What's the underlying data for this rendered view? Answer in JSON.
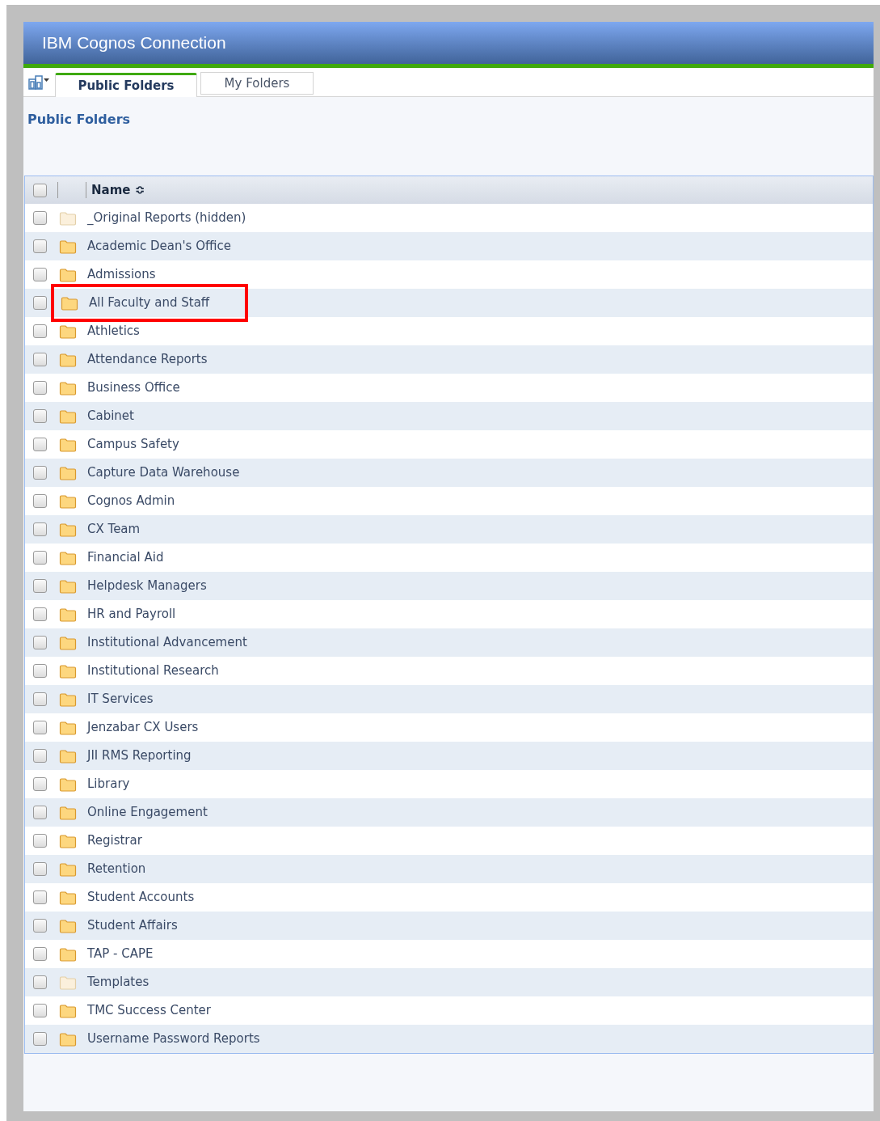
{
  "window": {
    "title": "IBM Cognos Connection"
  },
  "tabs": [
    {
      "label": "Public Folders",
      "selected": true
    },
    {
      "label": "My Folders",
      "selected": false
    }
  ],
  "breadcrumb": "Public Folders",
  "table": {
    "header_checked": false,
    "columns": [
      {
        "label": "Name",
        "sort_icon": "≎"
      }
    ],
    "rows": [
      {
        "name": "_Original Reports (hidden)",
        "hidden": true,
        "checked": false,
        "highlighted": false
      },
      {
        "name": "Academic Dean's Office",
        "hidden": false,
        "checked": false,
        "highlighted": false
      },
      {
        "name": "Admissions",
        "hidden": false,
        "checked": false,
        "highlighted": false
      },
      {
        "name": "All Faculty and Staff",
        "hidden": false,
        "checked": false,
        "highlighted": true
      },
      {
        "name": "Athletics",
        "hidden": false,
        "checked": false,
        "highlighted": false
      },
      {
        "name": "Attendance Reports",
        "hidden": false,
        "checked": false,
        "highlighted": false
      },
      {
        "name": "Business Office",
        "hidden": false,
        "checked": false,
        "highlighted": false
      },
      {
        "name": "Cabinet",
        "hidden": false,
        "checked": false,
        "highlighted": false
      },
      {
        "name": "Campus Safety",
        "hidden": false,
        "checked": false,
        "highlighted": false
      },
      {
        "name": "Capture Data Warehouse",
        "hidden": false,
        "checked": false,
        "highlighted": false
      },
      {
        "name": "Cognos Admin",
        "hidden": false,
        "checked": false,
        "highlighted": false
      },
      {
        "name": "CX Team",
        "hidden": false,
        "checked": false,
        "highlighted": false
      },
      {
        "name": "Financial Aid",
        "hidden": false,
        "checked": false,
        "highlighted": false
      },
      {
        "name": "Helpdesk Managers",
        "hidden": false,
        "checked": false,
        "highlighted": false
      },
      {
        "name": "HR and Payroll",
        "hidden": false,
        "checked": false,
        "highlighted": false
      },
      {
        "name": "Institutional Advancement",
        "hidden": false,
        "checked": false,
        "highlighted": false
      },
      {
        "name": "Institutional Research",
        "hidden": false,
        "checked": false,
        "highlighted": false
      },
      {
        "name": "IT Services",
        "hidden": false,
        "checked": false,
        "highlighted": false
      },
      {
        "name": "Jenzabar CX Users",
        "hidden": false,
        "checked": false,
        "highlighted": false
      },
      {
        "name": "JII RMS Reporting",
        "hidden": false,
        "checked": false,
        "highlighted": false
      },
      {
        "name": "Library",
        "hidden": false,
        "checked": false,
        "highlighted": false
      },
      {
        "name": "Online Engagement",
        "hidden": false,
        "checked": false,
        "highlighted": false
      },
      {
        "name": "Registrar",
        "hidden": false,
        "checked": false,
        "highlighted": false
      },
      {
        "name": "Retention",
        "hidden": false,
        "checked": false,
        "highlighted": false
      },
      {
        "name": "Student Accounts",
        "hidden": false,
        "checked": false,
        "highlighted": false
      },
      {
        "name": "Student Affairs",
        "hidden": false,
        "checked": false,
        "highlighted": false
      },
      {
        "name": "TAP - CAPE",
        "hidden": false,
        "checked": false,
        "highlighted": false
      },
      {
        "name": "Templates",
        "hidden": true,
        "checked": false,
        "highlighted": false
      },
      {
        "name": "TMC Success Center",
        "hidden": false,
        "checked": false,
        "highlighted": false
      },
      {
        "name": "Username Password Reports",
        "hidden": false,
        "checked": false,
        "highlighted": false
      }
    ]
  }
}
